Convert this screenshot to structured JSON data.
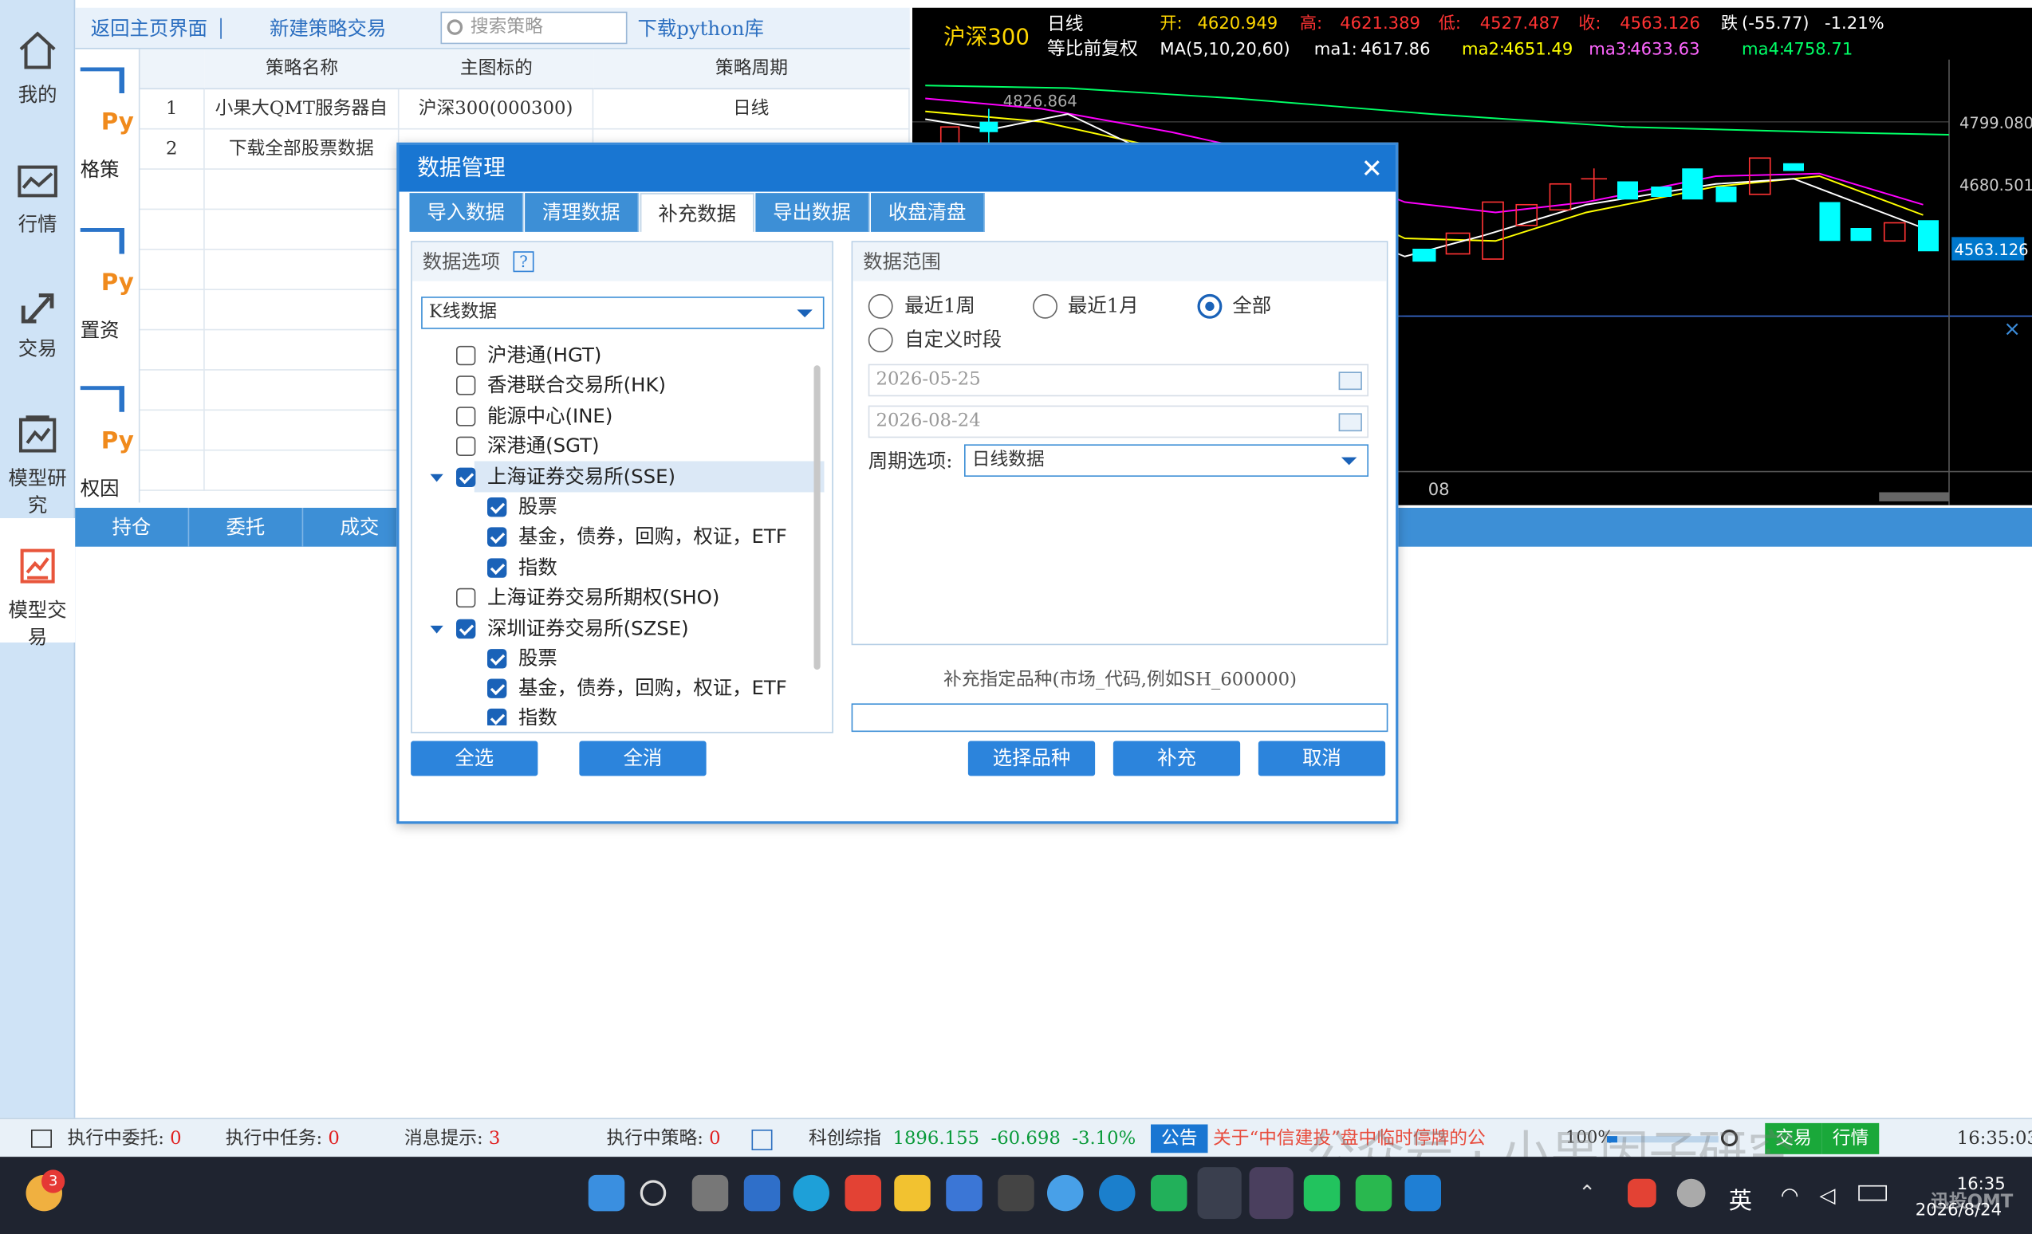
{
  "nav": [
    {
      "label": "我的",
      "icon": "home-icon"
    },
    {
      "label": "行情",
      "icon": "market-chart-icon"
    },
    {
      "label": "交易",
      "icon": "trade-arrows-icon"
    },
    {
      "label": "模型研究",
      "icon": "model-research-icon"
    },
    {
      "label": "模型交易",
      "icon": "model-trade-icon"
    }
  ],
  "toolbar": {
    "back_home": "返回主页界面",
    "new_strategy": "新建策略交易",
    "search_placeholder": "搜索策略",
    "download_python": "下载python库"
  },
  "strategy_cards": [
    {
      "label": "格策"
    },
    {
      "label": "置资"
    },
    {
      "label": "权因"
    }
  ],
  "strategy_table": {
    "columns": [
      "",
      "策略名称",
      "主图标的",
      "策略周期"
    ],
    "rows": [
      {
        "index": "1",
        "name": "小果大QMT服务器自",
        "target": "沪深300(000300)",
        "period": "日线"
      },
      {
        "index": "2",
        "name": "下载全部股票数据",
        "target": "",
        "period": ""
      }
    ]
  },
  "bottom_tabs": [
    "持仓",
    "委托",
    "成交"
  ],
  "chart": {
    "symbol": "沪深300",
    "period": "日线",
    "adjust": "等比前复权",
    "ma_label": "MA(5,10,20,60)",
    "open_label": "开:",
    "open": "4620.949",
    "high_label": "高:",
    "high": "4621.389",
    "low_label": "低:",
    "low": "4527.487",
    "close_label": "收:",
    "close": "4563.126",
    "change_label": "跌",
    "change": "(-55.77)",
    "change_pct": "-1.21%",
    "ma1_label": "ma1:",
    "ma1": "4617.86",
    "ma2_label": "ma2:",
    "ma2": "4651.49",
    "ma3_label": "ma3:",
    "ma3": "4633.63",
    "ma4_label": "ma4:",
    "ma4": "4758.71",
    "peak_label": "4826.864",
    "y_labels": [
      "4799.080",
      "4680.501"
    ],
    "price_tag": "4563.126",
    "x_label": "08",
    "colors": {
      "up": "#ff3333",
      "down": "#00ffff",
      "ma1": "#ffffff",
      "ma2": "#ffff00",
      "ma3": "#ff00ff",
      "ma4": "#00ff00"
    }
  },
  "dialog": {
    "title": "数据管理",
    "tabs": [
      "导入数据",
      "清理数据",
      "补充数据",
      "导出数据",
      "收盘清盘"
    ],
    "active_tab": "补充数据",
    "options_header": "数据选项",
    "help": "?",
    "kline_select": "K线数据",
    "tree": [
      {
        "label": "沪港通(HGT)",
        "checked": false,
        "level": 0
      },
      {
        "label": "香港联合交易所(HK)",
        "checked": false,
        "level": 0
      },
      {
        "label": "能源中心(INE)",
        "checked": false,
        "level": 0
      },
      {
        "label": "深港通(SGT)",
        "checked": false,
        "level": 0
      },
      {
        "label": "上海证券交易所(SSE)",
        "checked": true,
        "level": 0,
        "expanded": true
      },
      {
        "label": "股票",
        "checked": true,
        "level": 1
      },
      {
        "label": "基金，债券，回购，权证，ETF",
        "checked": true,
        "level": 1
      },
      {
        "label": "指数",
        "checked": true,
        "level": 1
      },
      {
        "label": "上海证券交易所期权(SHO)",
        "checked": false,
        "level": 0
      },
      {
        "label": "深圳证券交易所(SZSE)",
        "checked": true,
        "level": 0,
        "expanded": true
      },
      {
        "label": "股票",
        "checked": true,
        "level": 1
      },
      {
        "label": "基金，债券，回购，权证，ETF",
        "checked": true,
        "level": 1
      },
      {
        "label": "指数",
        "checked": true,
        "level": 1
      }
    ],
    "select_all": "全选",
    "deselect_all": "全消",
    "range_header": "数据范围",
    "range_options": {
      "week": "最近1周",
      "month": "最近1月",
      "all": "全部",
      "custom": "自定义时段"
    },
    "range_selected": "全部",
    "start_date": "2026-05-25",
    "end_date": "2026-08-24",
    "period_label": "周期选项:",
    "period_value": "日线数据",
    "specify_label": "补充指定品种(市场_代码,例如SH_600000)",
    "specify_value": "",
    "choose_btn": "选择品种",
    "supplement_btn": "补充",
    "cancel_btn": "取消"
  },
  "status": {
    "pending_orders_label": "执行中委托:",
    "pending_orders": "0",
    "tasks_label": "执行中任务:",
    "tasks": "0",
    "messages_label": "消息提示:",
    "messages": "3",
    "strategies_label": "执行中策略:",
    "strategies": "0",
    "index_name": "科创综指",
    "index_value": "1896.155",
    "index_change": "-60.698",
    "index_pct": "-3.10%",
    "notice_tag": "公告",
    "notice_text": "关于“中信建投”盘中临时停牌的公",
    "zoom": "100%",
    "trade_btn": "交易",
    "market_btn": "行情",
    "time": "16:35:03"
  },
  "watermark": "公众号 · 小果因子研究",
  "taskbar": {
    "badge": "3",
    "ime": "英",
    "clock_time": "16:35",
    "clock_date": "2026/8/24",
    "brand": "迅投QMT"
  }
}
